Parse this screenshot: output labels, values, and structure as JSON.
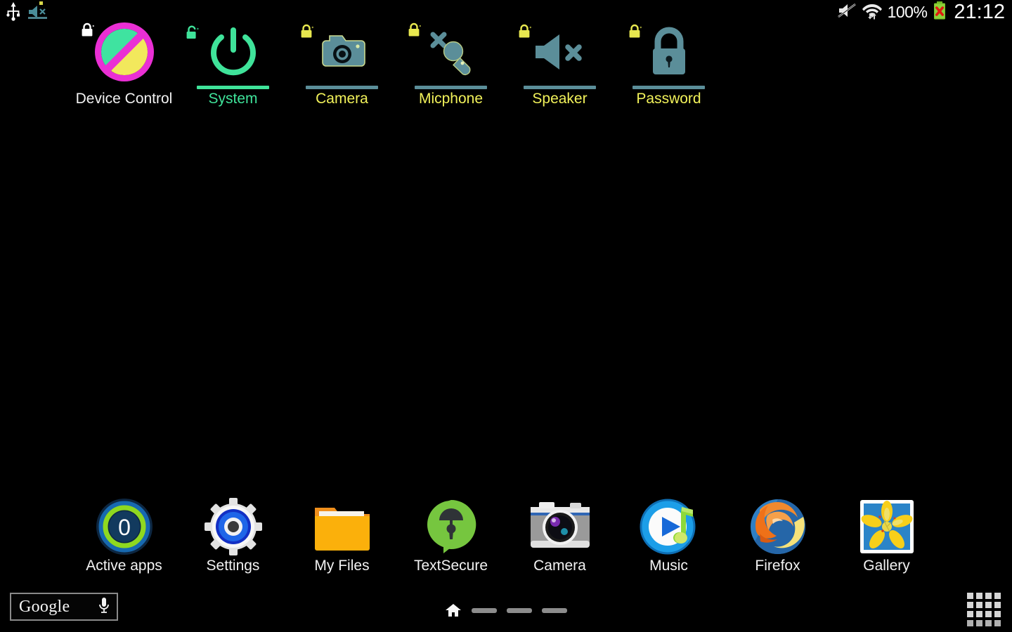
{
  "status_bar": {
    "left_icons": [
      {
        "name": "usb-icon",
        "label": "USB connected"
      },
      {
        "name": "speaker-muted-notification-icon",
        "label": "Speaker muted"
      }
    ],
    "silent_mode_icon": "mute-bell-icon",
    "wifi_icon": "wifi-transfer-icon",
    "battery_percent": "100%",
    "battery_icon": "battery-error-icon",
    "clock": "21:12"
  },
  "widgets": [
    {
      "label": "Device Control",
      "icon": "prohibited-circle-icon",
      "label_color": "#f2f2f2",
      "lock_state": "locked",
      "lock_color": "#ffffff",
      "bar_color": "",
      "accent": "#ea2fd4"
    },
    {
      "label": "System",
      "icon": "power-icon",
      "label_color": "#3fe39a",
      "lock_state": "unlocked",
      "lock_color": "#3fe39a",
      "bar_color": "#3fe39a",
      "accent": "#3fe39a"
    },
    {
      "label": "Camera",
      "icon": "camera-icon",
      "label_color": "#f2f25a",
      "lock_state": "locked",
      "lock_color": "#e8e84f",
      "bar_color": "#5b8e99",
      "accent": "#5b8e99"
    },
    {
      "label": "Micphone",
      "icon": "microphone-muted-icon",
      "label_color": "#f2f25a",
      "lock_state": "locked",
      "lock_color": "#e8e84f",
      "bar_color": "#5b8e99",
      "accent": "#5b8e99"
    },
    {
      "label": "Speaker",
      "icon": "speaker-muted-icon",
      "label_color": "#f2f25a",
      "lock_state": "locked",
      "lock_color": "#e8e84f",
      "bar_color": "#5b8e99",
      "accent": "#5b8e99"
    },
    {
      "label": "Password",
      "icon": "padlock-icon",
      "label_color": "#f2f25a",
      "lock_state": "locked",
      "lock_color": "#e8e84f",
      "bar_color": "#5b8e99",
      "accent": "#5b8e99"
    }
  ],
  "dock": [
    {
      "label": "Active apps",
      "icon": "active-apps-counter-icon",
      "badge_count": "0"
    },
    {
      "label": "Settings",
      "icon": "gear-icon"
    },
    {
      "label": "My Files",
      "icon": "folder-icon"
    },
    {
      "label": "TextSecure",
      "icon": "textsecure-lock-bubble-icon"
    },
    {
      "label": "Camera",
      "icon": "camera-app-icon"
    },
    {
      "label": "Music",
      "icon": "music-play-note-icon"
    },
    {
      "label": "Firefox",
      "icon": "firefox-icon"
    },
    {
      "label": "Gallery",
      "icon": "gallery-flower-icon"
    }
  ],
  "bottom_bar": {
    "search_wordmark": "Google",
    "mic_icon": "microphone-icon",
    "home_icon": "home-icon",
    "page_count": 3,
    "app_drawer_icon": "app-grid-icon"
  }
}
